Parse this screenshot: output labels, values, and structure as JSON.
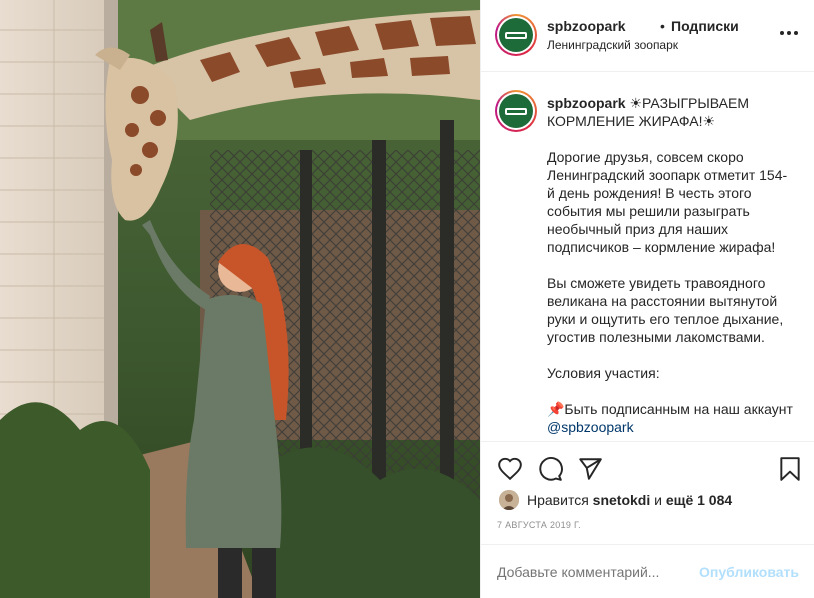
{
  "post": {
    "username": "spbzoopark",
    "dot": "•",
    "follow_label": "Подписки",
    "location": "Ленинградский зоопарк",
    "caption": {
      "username": "spbzoopark",
      "line1": "☀РАЗЫГРЫВАЕМ КОРМЛЕНИЕ ЖИРАФА!☀",
      "para1": "Дорогие друзья, совсем скоро Ленинградский зоопарк отметит 154-й день рождения! В честь этого события мы решили разыграть необычный приз для наших подписчиков – кормление жирафа!",
      "para2": "Вы сможете увидеть травоядного великана на расстоянии вытянутой руки и ощутить его теплое дыхание, угостив полезными лакомствами.",
      "para3": "Условия участия:",
      "para4": "📌Быть подписанным на наш аккаунт",
      "mention": "@spbzoopark"
    },
    "likes": {
      "prefix": "Нравится",
      "user": "snetokdi",
      "and": "и",
      "rest": "ещё 1 084"
    },
    "date": "7 АВГУСТА 2019 Г.",
    "comment_placeholder": "Добавьте комментарий...",
    "publish_label": "Опубликовать",
    "colors": {
      "accent_link": "#00376b",
      "publish_disabled": "#b2dffc",
      "logo_green": "#1e6b3a"
    },
    "icons": [
      "heart-icon",
      "comment-icon",
      "share-icon",
      "bookmark-icon",
      "more-icon"
    ]
  }
}
